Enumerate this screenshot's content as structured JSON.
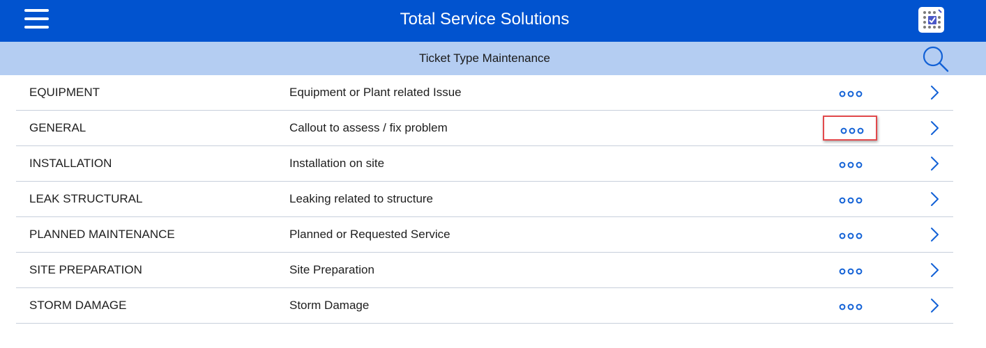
{
  "app": {
    "title": "Total Service Solutions"
  },
  "subheader": {
    "title": "Ticket Type Maintenance"
  },
  "colors": {
    "topbar": "#0153cf",
    "subbar": "#b4cdf2",
    "accent": "#0153cf",
    "highlight": "#e2494c",
    "divider": "#c7cfdb"
  },
  "icons": {
    "menu": "hamburger-icon",
    "logo": "app-logo-icon",
    "search": "search-icon",
    "more": "more-options-icon",
    "open": "chevron-right-icon"
  },
  "ticket_types": [
    {
      "code": "EQUIPMENT",
      "description": "Equipment or Plant related Issue",
      "highlighted": false
    },
    {
      "code": "GENERAL",
      "description": "Callout to assess / fix problem",
      "highlighted": true
    },
    {
      "code": "INSTALLATION",
      "description": "Installation on site",
      "highlighted": false
    },
    {
      "code": "LEAK STRUCTURAL",
      "description": "Leaking related to structure",
      "highlighted": false
    },
    {
      "code": "PLANNED MAINTENANCE",
      "description": "Planned or Requested Service",
      "highlighted": false
    },
    {
      "code": "SITE PREPARATION",
      "description": "Site Preparation",
      "highlighted": false
    },
    {
      "code": "STORM DAMAGE",
      "description": "Storm Damage",
      "highlighted": false
    }
  ]
}
